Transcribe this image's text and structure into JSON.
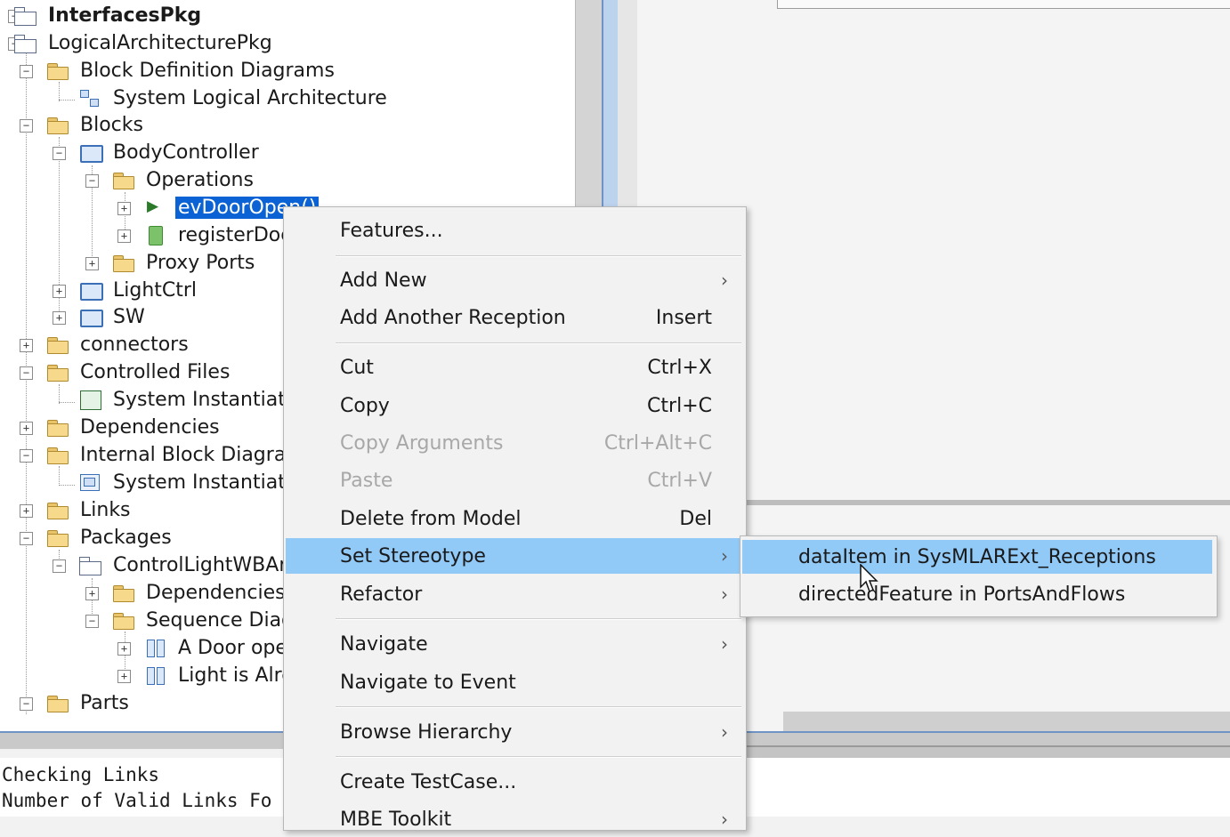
{
  "tree": {
    "rows": [
      {
        "label": "InterfacesPkg",
        "bold": true
      },
      {
        "label": "LogicalArchitecturePkg"
      },
      {
        "label": "Block Definition Diagrams"
      },
      {
        "label": "System Logical Architecture"
      },
      {
        "label": "Blocks"
      },
      {
        "label": "BodyController"
      },
      {
        "label": "Operations"
      },
      {
        "label": "evDoorOpen()"
      },
      {
        "label": "registerDoc"
      },
      {
        "label": "Proxy Ports"
      },
      {
        "label": "LightCtrl"
      },
      {
        "label": "SW"
      },
      {
        "label": "connectors"
      },
      {
        "label": "Controlled Files"
      },
      {
        "label": "System Instantiatic"
      },
      {
        "label": "Dependencies"
      },
      {
        "label": "Internal Block Diagram"
      },
      {
        "label": "System Instantiatic"
      },
      {
        "label": "Links"
      },
      {
        "label": "Packages"
      },
      {
        "label": "ControlLightWBAr"
      },
      {
        "label": "Dependencies"
      },
      {
        "label": "Sequence Diag"
      },
      {
        "label": "A Door ope"
      },
      {
        "label": "Light is Alre"
      },
      {
        "label": "Parts"
      }
    ]
  },
  "context_menu": {
    "items": [
      {
        "label": "Features...",
        "shortcut": ""
      },
      {
        "label": "Add New",
        "shortcut": ""
      },
      {
        "label": "Add Another Reception",
        "shortcut": "Insert"
      },
      {
        "label": "Cut",
        "shortcut": "Ctrl+X"
      },
      {
        "label": "Copy",
        "shortcut": "Ctrl+C"
      },
      {
        "label": "Copy Arguments",
        "shortcut": "Ctrl+Alt+C"
      },
      {
        "label": "Paste",
        "shortcut": "Ctrl+V"
      },
      {
        "label": "Delete from Model",
        "shortcut": "Del"
      },
      {
        "label": "Set Stereotype",
        "shortcut": ""
      },
      {
        "label": "Refactor",
        "shortcut": ""
      },
      {
        "label": "Navigate",
        "shortcut": ""
      },
      {
        "label": "Navigate to Event",
        "shortcut": ""
      },
      {
        "label": "Browse Hierarchy",
        "shortcut": ""
      },
      {
        "label": "Create TestCase...",
        "shortcut": ""
      },
      {
        "label": "MBE Toolkit",
        "shortcut": ""
      }
    ],
    "submenu_arrow": "›"
  },
  "stereotype_submenu": {
    "items": [
      {
        "label": "dataItem in SysMLARExt_Receptions"
      },
      {
        "label": "directedFeature in PortsAndFlows"
      }
    ]
  },
  "output": {
    "lines": [
      "Checking Links",
      "Number of Valid Links Fo"
    ]
  },
  "colors": {
    "selection": "#0a62d4",
    "menu_highlight": "#91c9f7"
  }
}
